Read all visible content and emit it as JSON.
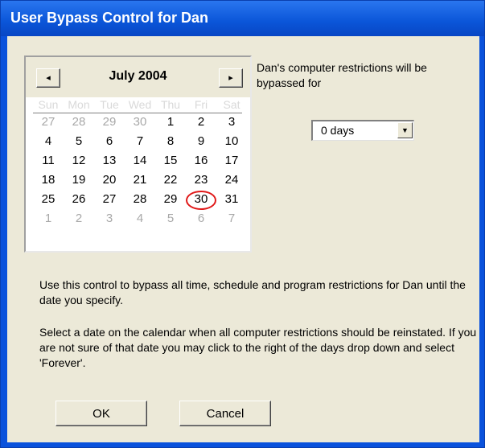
{
  "window": {
    "title": "User Bypass Control for Dan"
  },
  "calendar": {
    "month_label": "July 2004",
    "prev_glyph": "◂",
    "next_glyph": "▸",
    "weekdays": [
      "Sun",
      "Mon",
      "Tue",
      "Wed",
      "Thu",
      "Fri",
      "Sat"
    ],
    "weeks": [
      [
        "27",
        "28",
        "29",
        "30",
        "1",
        "2",
        "3"
      ],
      [
        "4",
        "5",
        "6",
        "7",
        "8",
        "9",
        "10"
      ],
      [
        "11",
        "12",
        "13",
        "14",
        "15",
        "16",
        "17"
      ],
      [
        "18",
        "19",
        "20",
        "21",
        "22",
        "23",
        "24"
      ],
      [
        "25",
        "26",
        "27",
        "28",
        "29",
        "30",
        "31"
      ],
      [
        "1",
        "2",
        "3",
        "4",
        "5",
        "6",
        "7"
      ]
    ],
    "selected_day": "30",
    "selection_color": "#e01818"
  },
  "bypass": {
    "description": "Dan's computer restrictions will be bypassed for",
    "duration_value": "0 days",
    "dropdown_glyph": "▼"
  },
  "help": {
    "paragraph1": "Use this control to bypass all time, schedule and program restrictions for Dan until the date you specify.",
    "paragraph2": "Select a date on the calendar when all computer restrictions should be reinstated. If you are not sure of that date you may click to the right of the days drop down and select 'Forever'."
  },
  "buttons": {
    "ok": "OK",
    "cancel": "Cancel"
  },
  "colors": {
    "titlebar": "#0a55d8",
    "dialog_bg": "#ece9d8"
  }
}
